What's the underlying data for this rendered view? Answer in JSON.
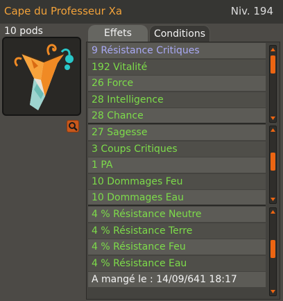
{
  "item": {
    "name": "Cape du Professeur Xa",
    "level": "Niv. 194",
    "weight": "10 pods"
  },
  "colors": {
    "name": "#f2a23a",
    "effect_green": "#7ddc4a",
    "effect_critical": "#a9a9f4",
    "eaten_text": "#f4f4f4",
    "scrollbar_thumb": "#ec6512"
  },
  "icons": {
    "zoom": "magnifier-icon"
  },
  "tabs": [
    {
      "label": "Effets",
      "active": true
    },
    {
      "label": "Conditions",
      "active": false
    }
  ],
  "effects": [
    {
      "text": "9 Résistance Critiques",
      "color": "#a9a9f4"
    },
    {
      "text": "192 Vitalité",
      "color": "#7ddc4a"
    },
    {
      "text": "26 Force",
      "color": "#7ddc4a"
    },
    {
      "text": "28 Intelligence",
      "color": "#7ddc4a"
    },
    {
      "text": "28 Chance",
      "color": "#7ddc4a"
    },
    {
      "text": "27 Sagesse",
      "color": "#7ddc4a"
    },
    {
      "text": "3 Coups Critiques",
      "color": "#7ddc4a"
    },
    {
      "text": "1 PA",
      "color": "#7ddc4a"
    },
    {
      "text": "10 Dommages Feu",
      "color": "#7ddc4a"
    },
    {
      "text": "10 Dommages Eau",
      "color": "#7ddc4a"
    },
    {
      "text": "4 % Résistance Neutre",
      "color": "#7ddc4a"
    },
    {
      "text": "4 % Résistance Terre",
      "color": "#7ddc4a"
    },
    {
      "text": "4 % Résistance Feu",
      "color": "#7ddc4a"
    },
    {
      "text": "4 % Résistance Eau",
      "color": "#7ddc4a"
    },
    {
      "text": "A mangé le : 14/09/641 18:17",
      "color": "#f4f4f4"
    }
  ]
}
